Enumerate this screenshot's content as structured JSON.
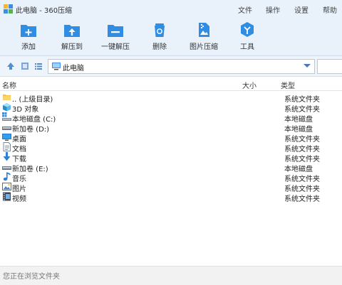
{
  "window": {
    "title": "此电脑 - 360压缩"
  },
  "menu": {
    "file": "文件",
    "ops": "操作",
    "settings": "设置",
    "help": "帮助"
  },
  "toolbar": {
    "add": "添加",
    "extract_to": "解压到",
    "one_click_extract": "一键解压",
    "delete": "删除",
    "image_compress": "图片压缩",
    "tools": "工具"
  },
  "address": {
    "current": "此电脑"
  },
  "columns": {
    "name": "名称",
    "size": "大小",
    "type": "类型"
  },
  "rows": [
    {
      "name": ".. (上级目录)",
      "type": "系统文件夹",
      "icon": "folder-up-icon"
    },
    {
      "name": "3D 对象",
      "type": "系统文件夹",
      "icon": "3d-objects-icon"
    },
    {
      "name": "本地磁盘 (C:)",
      "type": "本地磁盘",
      "icon": "system-drive-icon"
    },
    {
      "name": "新加卷 (D:)",
      "type": "本地磁盘",
      "icon": "drive-icon"
    },
    {
      "name": "桌面",
      "type": "系统文件夹",
      "icon": "desktop-icon"
    },
    {
      "name": "文档",
      "type": "系统文件夹",
      "icon": "documents-icon"
    },
    {
      "name": "下载",
      "type": "系统文件夹",
      "icon": "download-icon"
    },
    {
      "name": "新加卷 (E:)",
      "type": "本地磁盘",
      "icon": "drive-icon"
    },
    {
      "name": "音乐",
      "type": "系统文件夹",
      "icon": "music-icon"
    },
    {
      "name": "图片",
      "type": "系统文件夹",
      "icon": "pictures-icon"
    },
    {
      "name": "视频",
      "type": "系统文件夹",
      "icon": "videos-icon"
    }
  ],
  "status": {
    "text": "您正在浏览文件夹"
  },
  "colors": {
    "accent": "#2f8de4",
    "toolbar_bg": "#e9f1fb",
    "folder": "#f5c342"
  }
}
